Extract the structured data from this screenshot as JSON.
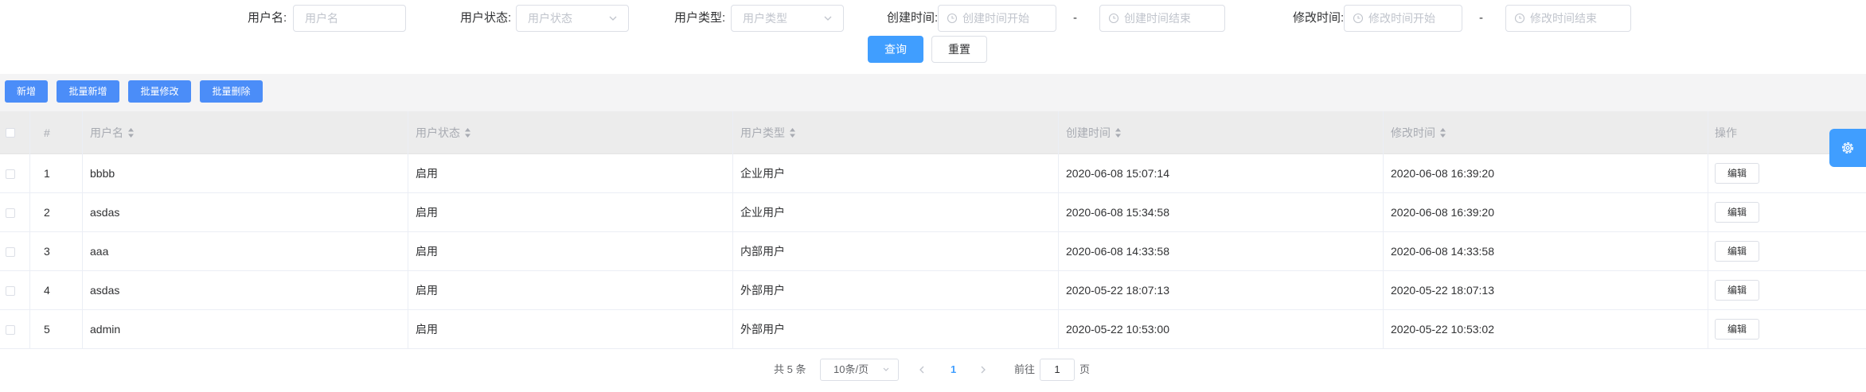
{
  "filters": {
    "username": {
      "label": "用户名:",
      "placeholder": "用户名"
    },
    "status": {
      "label": "用户状态:",
      "placeholder": "用户状态"
    },
    "type": {
      "label": "用户类型:",
      "placeholder": "用户类型"
    },
    "created": {
      "label": "创建时间:",
      "start_placeholder": "创建时间开始",
      "end_placeholder": "创建时间结束",
      "separator": "-"
    },
    "modified": {
      "label": "修改时间:",
      "start_placeholder": "修改时间开始",
      "end_placeholder": "修改时间结束",
      "separator": "-"
    },
    "query_label": "查询",
    "reset_label": "重置"
  },
  "toolbar": {
    "add_label": "新增",
    "batch_add_label": "批量新增",
    "batch_edit_label": "批量修改",
    "batch_delete_label": "批量删除"
  },
  "table": {
    "columns": {
      "index": "#",
      "username": "用户名",
      "status": "用户状态",
      "type": "用户类型",
      "created": "创建时间",
      "modified": "修改时间",
      "actions": "操作"
    },
    "rows": [
      {
        "index": "1",
        "username": "bbbb",
        "status": "启用",
        "type": "企业用户",
        "created": "2020-06-08 15:07:14",
        "modified": "2020-06-08 16:39:20",
        "action": "编辑"
      },
      {
        "index": "2",
        "username": "asdas",
        "status": "启用",
        "type": "企业用户",
        "created": "2020-06-08 15:34:58",
        "modified": "2020-06-08 16:39:20",
        "action": "编辑"
      },
      {
        "index": "3",
        "username": "aaa",
        "status": "启用",
        "type": "内部用户",
        "created": "2020-06-08 14:33:58",
        "modified": "2020-06-08 14:33:58",
        "action": "编辑"
      },
      {
        "index": "4",
        "username": "asdas",
        "status": "启用",
        "type": "外部用户",
        "created": "2020-05-22 18:07:13",
        "modified": "2020-05-22 18:07:13",
        "action": "编辑"
      },
      {
        "index": "5",
        "username": "admin",
        "status": "启用",
        "type": "外部用户",
        "created": "2020-05-22 10:53:00",
        "modified": "2020-05-22 10:53:02",
        "action": "编辑"
      }
    ]
  },
  "pagination": {
    "total_text": "共 5 条",
    "page_size": "10条/页",
    "current_page": "1",
    "goto_prefix": "前往",
    "goto_value": "1",
    "goto_suffix": "页"
  },
  "icons": {
    "settings": "gear-icon",
    "clock": "clock-icon",
    "dropdown": "chevron-down-icon",
    "sort": "sort-caret-icon",
    "prev": "chevron-left-icon",
    "next": "chevron-right-icon"
  },
  "colors": {
    "primary": "#409eff",
    "toolbar_button": "#4b8df8",
    "header_bg": "#ececec",
    "toolbar_bg": "#f4f4f5",
    "border": "#dcdfe6"
  }
}
